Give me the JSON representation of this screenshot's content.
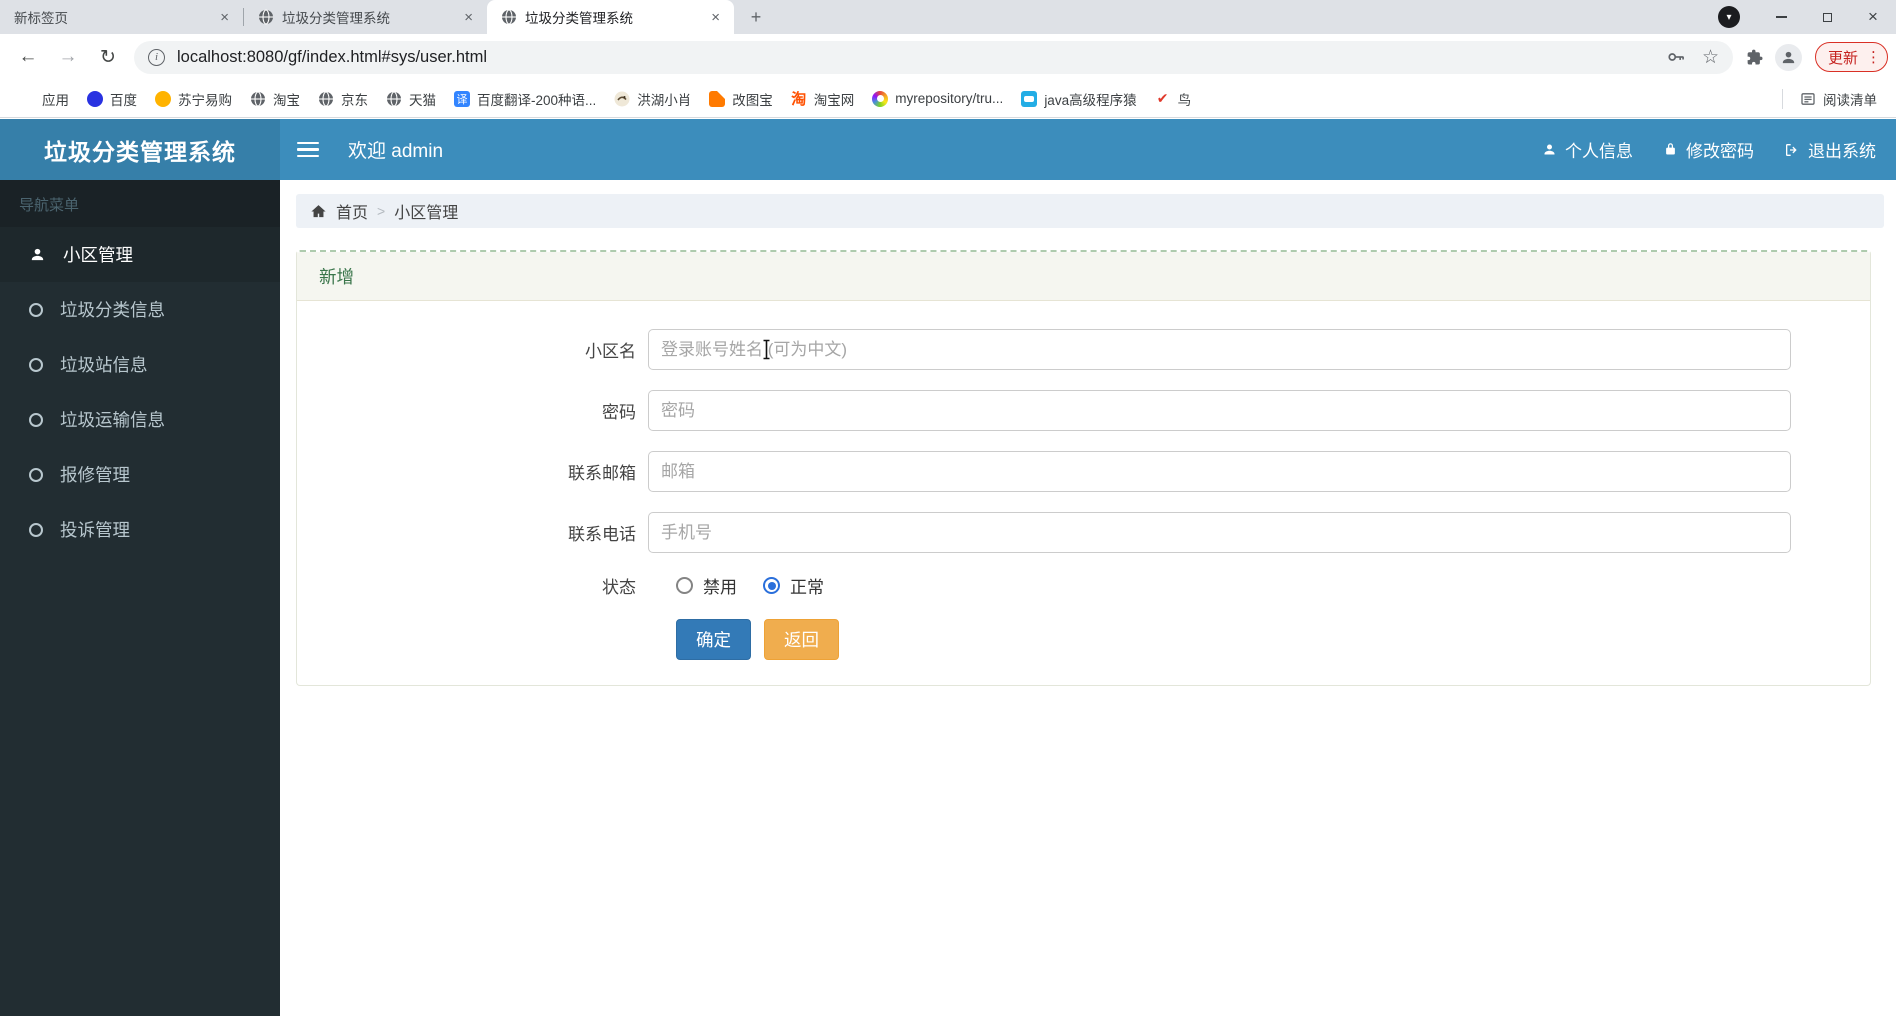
{
  "browser": {
    "tabs": [
      {
        "title": "新标签页"
      },
      {
        "title": "垃圾分类管理系统",
        "icon": "globe-icon"
      },
      {
        "title": "垃圾分类管理系统",
        "icon": "globe-icon",
        "active": true
      }
    ],
    "url": "localhost:8080/gf/index.html#sys/user.html",
    "update_button": "更新",
    "bookmarks": [
      {
        "label": "应用",
        "icon": "apps-grid-icon"
      },
      {
        "label": "百度",
        "icon": "baidu-icon"
      },
      {
        "label": "苏宁易购",
        "icon": "suning-icon"
      },
      {
        "label": "淘宝",
        "icon": "globe-icon"
      },
      {
        "label": "京东",
        "icon": "globe-icon"
      },
      {
        "label": "天猫",
        "icon": "globe-icon"
      },
      {
        "label": "百度翻译-200种语...",
        "icon": "baidu-translate-icon"
      },
      {
        "label": "洪湖小肖",
        "icon": "eagle-icon"
      },
      {
        "label": "改图宝",
        "icon": "gaitubao-icon"
      },
      {
        "label": "淘宝网",
        "icon": "taobao-icon"
      },
      {
        "label": "myrepository/tru...",
        "icon": "rainbow-ring-icon"
      },
      {
        "label": "java高级程序猿",
        "icon": "robot-icon"
      },
      {
        "label": "鸟",
        "icon": "red-bird-icon"
      }
    ],
    "reading_list": "阅读清单"
  },
  "app": {
    "title": "垃圾分类管理系统",
    "welcome": "欢迎 admin",
    "nav_right": [
      {
        "label": "个人信息",
        "icon": "user-icon"
      },
      {
        "label": "修改密码",
        "icon": "lock-icon"
      },
      {
        "label": "退出系统",
        "icon": "logout-icon"
      }
    ],
    "sidebar": {
      "header": "导航菜单",
      "items": [
        {
          "label": "小区管理",
          "icon": "user-icon",
          "active": true
        },
        {
          "label": "垃圾分类信息",
          "icon": "circle-icon"
        },
        {
          "label": "垃圾站信息",
          "icon": "circle-icon"
        },
        {
          "label": "垃圾运输信息",
          "icon": "circle-icon"
        },
        {
          "label": "报修管理",
          "icon": "circle-icon"
        },
        {
          "label": "投诉管理",
          "icon": "circle-icon"
        }
      ]
    },
    "breadcrumb": {
      "home": "首页",
      "current": "小区管理"
    },
    "panel": {
      "title": "新增",
      "form": {
        "fields": [
          {
            "label": "小区名",
            "placeholder": "登录账号姓名 (可为中文)"
          },
          {
            "label": "密码",
            "placeholder": "密码"
          },
          {
            "label": "联系邮箱",
            "placeholder": "邮箱"
          },
          {
            "label": "联系电话",
            "placeholder": "手机号"
          }
        ],
        "status": {
          "label": "状态",
          "options": [
            {
              "label": "禁用",
              "checked": false
            },
            {
              "label": "正常",
              "checked": true
            }
          ]
        },
        "buttons": {
          "submit": "确定",
          "back": "返回"
        }
      }
    }
  },
  "colors": {
    "header_blue": "#3c8dbc",
    "logo_blue": "#367fa9",
    "sidebar_dark": "#222d32",
    "primary_button": "#337ab7",
    "warning_button": "#f0ad4e",
    "panel_title_green": "#39754a",
    "radio_checked_blue": "#2a6fdb",
    "update_red": "#c5221f"
  }
}
